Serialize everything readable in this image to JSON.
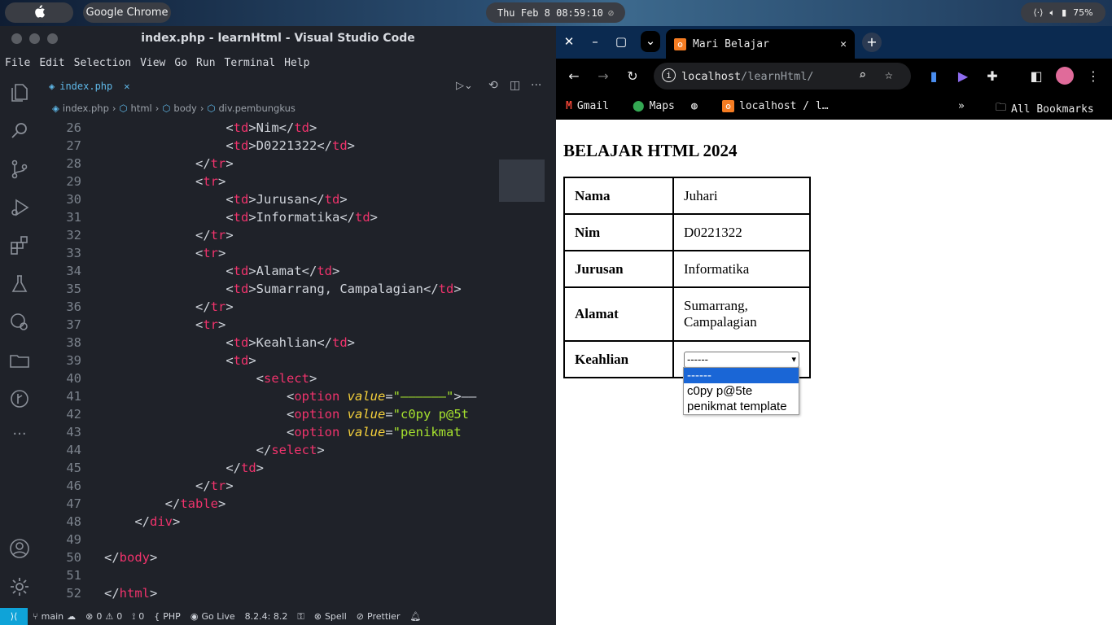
{
  "system": {
    "app_name": "Google Chrome",
    "clock": "Thu Feb 8 08:59:10",
    "battery": "75%"
  },
  "vscode": {
    "title": "index.php - learnHtml - Visual Studio Code",
    "menu": [
      "File",
      "Edit",
      "Selection",
      "View",
      "Go",
      "Run",
      "Terminal",
      "Help"
    ],
    "tab_name": "index.php",
    "breadcrumbs": [
      "index.php",
      "html",
      "body",
      "div.pembungkus"
    ],
    "code_lines": [
      {
        "n": "26",
        "indent": 4,
        "tokens": [
          [
            "br",
            "<"
          ],
          [
            "tag",
            "td"
          ],
          [
            "br",
            ">"
          ],
          [
            "txt",
            "Nim"
          ],
          [
            "br",
            "</"
          ],
          [
            "tag",
            "td"
          ],
          [
            "br",
            ">"
          ]
        ]
      },
      {
        "n": "27",
        "indent": 4,
        "tokens": [
          [
            "br",
            "<"
          ],
          [
            "tag",
            "td"
          ],
          [
            "br",
            ">"
          ],
          [
            "txt",
            "D0221322"
          ],
          [
            "br",
            "</"
          ],
          [
            "tag",
            "td"
          ],
          [
            "br",
            ">"
          ]
        ]
      },
      {
        "n": "28",
        "indent": 3,
        "tokens": [
          [
            "br",
            "</"
          ],
          [
            "tag",
            "tr"
          ],
          [
            "br",
            ">"
          ]
        ]
      },
      {
        "n": "29",
        "indent": 3,
        "tokens": [
          [
            "br",
            "<"
          ],
          [
            "tag",
            "tr"
          ],
          [
            "br",
            ">"
          ]
        ]
      },
      {
        "n": "30",
        "indent": 4,
        "tokens": [
          [
            "br",
            "<"
          ],
          [
            "tag",
            "td"
          ],
          [
            "br",
            ">"
          ],
          [
            "txt",
            "Jurusan"
          ],
          [
            "br",
            "</"
          ],
          [
            "tag",
            "td"
          ],
          [
            "br",
            ">"
          ]
        ]
      },
      {
        "n": "31",
        "indent": 4,
        "tokens": [
          [
            "br",
            "<"
          ],
          [
            "tag",
            "td"
          ],
          [
            "br",
            ">"
          ],
          [
            "txt",
            "Informatika"
          ],
          [
            "br",
            "</"
          ],
          [
            "tag",
            "td"
          ],
          [
            "br",
            ">"
          ]
        ]
      },
      {
        "n": "32",
        "indent": 3,
        "tokens": [
          [
            "br",
            "</"
          ],
          [
            "tag",
            "tr"
          ],
          [
            "br",
            ">"
          ]
        ]
      },
      {
        "n": "33",
        "indent": 3,
        "tokens": [
          [
            "br",
            "<"
          ],
          [
            "tag",
            "tr"
          ],
          [
            "br",
            ">"
          ]
        ]
      },
      {
        "n": "34",
        "indent": 4,
        "tokens": [
          [
            "br",
            "<"
          ],
          [
            "tag",
            "td"
          ],
          [
            "br",
            ">"
          ],
          [
            "txt",
            "Alamat"
          ],
          [
            "br",
            "</"
          ],
          [
            "tag",
            "td"
          ],
          [
            "br",
            ">"
          ]
        ]
      },
      {
        "n": "35",
        "indent": 4,
        "tokens": [
          [
            "br",
            "<"
          ],
          [
            "tag",
            "td"
          ],
          [
            "br",
            ">"
          ],
          [
            "txt",
            "Sumarrang, Campalagian"
          ],
          [
            "br",
            "</"
          ],
          [
            "tag",
            "td"
          ],
          [
            "br",
            ">"
          ]
        ]
      },
      {
        "n": "36",
        "indent": 3,
        "tokens": [
          [
            "br",
            "</"
          ],
          [
            "tag",
            "tr"
          ],
          [
            "br",
            ">"
          ]
        ]
      },
      {
        "n": "37",
        "indent": 3,
        "tokens": [
          [
            "br",
            "<"
          ],
          [
            "tag",
            "tr"
          ],
          [
            "br",
            ">"
          ]
        ]
      },
      {
        "n": "38",
        "indent": 4,
        "tokens": [
          [
            "br",
            "<"
          ],
          [
            "tag",
            "td"
          ],
          [
            "br",
            ">"
          ],
          [
            "txt",
            "Keahlian"
          ],
          [
            "br",
            "</"
          ],
          [
            "tag",
            "td"
          ],
          [
            "br",
            ">"
          ]
        ]
      },
      {
        "n": "39",
        "indent": 4,
        "tokens": [
          [
            "br",
            "<"
          ],
          [
            "tag",
            "td"
          ],
          [
            "br",
            ">"
          ]
        ]
      },
      {
        "n": "40",
        "indent": 5,
        "tokens": [
          [
            "br",
            "<"
          ],
          [
            "tag",
            "select"
          ],
          [
            "br",
            ">"
          ]
        ]
      },
      {
        "n": "41",
        "indent": 6,
        "tokens": [
          [
            "br",
            "<"
          ],
          [
            "tag",
            "option"
          ],
          [
            "br",
            " "
          ],
          [
            "attr",
            "value"
          ],
          [
            "br",
            "="
          ],
          [
            "str",
            "\"——————\""
          ],
          [
            "br",
            ">——"
          ]
        ]
      },
      {
        "n": "42",
        "indent": 6,
        "tokens": [
          [
            "br",
            "<"
          ],
          [
            "tag",
            "option"
          ],
          [
            "br",
            " "
          ],
          [
            "attr",
            "value"
          ],
          [
            "br",
            "="
          ],
          [
            "str",
            "\"c0py p@5t"
          ]
        ]
      },
      {
        "n": "43",
        "indent": 6,
        "tokens": [
          [
            "br",
            "<"
          ],
          [
            "tag",
            "option"
          ],
          [
            "br",
            " "
          ],
          [
            "attr",
            "value"
          ],
          [
            "br",
            "="
          ],
          [
            "str",
            "\"penikmat"
          ]
        ]
      },
      {
        "n": "44",
        "indent": 5,
        "tokens": [
          [
            "br",
            "</"
          ],
          [
            "tag",
            "select"
          ],
          [
            "br",
            ">"
          ]
        ]
      },
      {
        "n": "45",
        "indent": 4,
        "tokens": [
          [
            "br",
            "</"
          ],
          [
            "tag",
            "td"
          ],
          [
            "br",
            ">"
          ]
        ]
      },
      {
        "n": "46",
        "indent": 3,
        "tokens": [
          [
            "br",
            "</"
          ],
          [
            "tag",
            "tr"
          ],
          [
            "br",
            ">"
          ]
        ]
      },
      {
        "n": "47",
        "indent": 2,
        "tokens": [
          [
            "br",
            "</"
          ],
          [
            "tag",
            "table"
          ],
          [
            "br",
            ">"
          ]
        ]
      },
      {
        "n": "48",
        "indent": 1,
        "tokens": [
          [
            "br",
            "</"
          ],
          [
            "tag",
            "div"
          ],
          [
            "br",
            ">"
          ]
        ]
      },
      {
        "n": "49",
        "indent": 0,
        "tokens": []
      },
      {
        "n": "50",
        "indent": 0,
        "tokens": [
          [
            "br",
            "</"
          ],
          [
            "tag",
            "body"
          ],
          [
            "br",
            ">"
          ]
        ]
      },
      {
        "n": "51",
        "indent": 0,
        "tokens": []
      },
      {
        "n": "52",
        "indent": 0,
        "tokens": [
          [
            "br",
            "</"
          ],
          [
            "tag",
            "html"
          ],
          [
            "br",
            ">"
          ]
        ]
      }
    ],
    "status": {
      "branch": "main",
      "errors": "0",
      "warnings": "0",
      "ports": "0",
      "language": "PHP",
      "golive": "Go Live",
      "version": "8.2.4: 8.2",
      "spell": "Spell",
      "prettier": "Prettier"
    }
  },
  "chrome": {
    "tab_title": "Mari Belajar",
    "url_host": "localhost",
    "url_path": "/learnHtml/",
    "bookmarks": [
      "Gmail",
      "Maps",
      "localhost / l…"
    ],
    "all_bookmarks": "All Bookmarks",
    "page": {
      "heading": "BELAJAR HTML 2024",
      "rows": [
        {
          "key": "Nama",
          "value": "Juhari"
        },
        {
          "key": "Nim",
          "value": "D0221322"
        },
        {
          "key": "Jurusan",
          "value": "Informatika"
        },
        {
          "key": "Alamat",
          "value": "Sumarrang, Campalagian"
        }
      ],
      "select_row_key": "Keahlian",
      "select_value": "------",
      "options": [
        "------",
        "c0py p@5te",
        "penikmat template"
      ]
    }
  }
}
